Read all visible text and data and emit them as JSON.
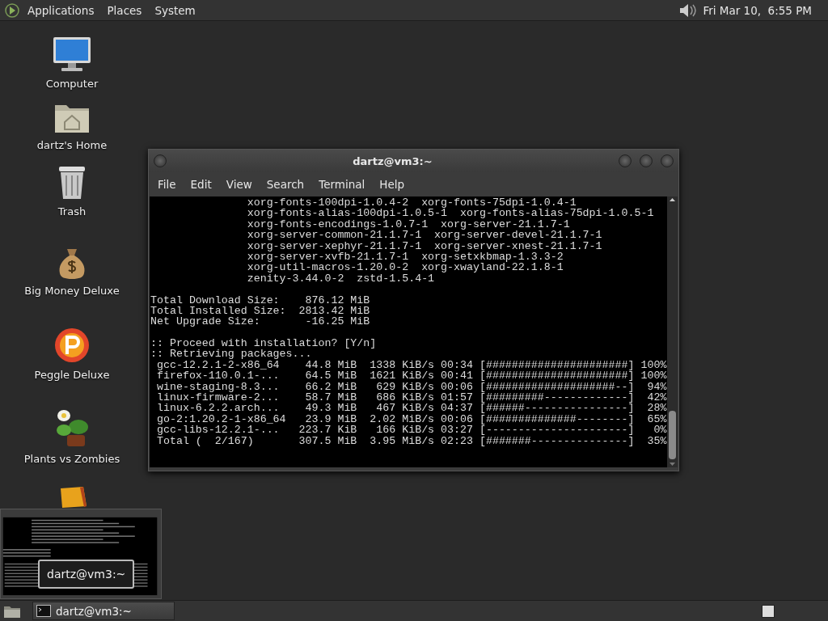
{
  "top_panel": {
    "menus": [
      "Applications",
      "Places",
      "System"
    ],
    "clock": "Fri Mar 10,  6:55 PM"
  },
  "desktop_icons": [
    {
      "label": "Computer",
      "kind": "computer"
    },
    {
      "label": "dartz's Home",
      "kind": "home"
    },
    {
      "label": "Trash",
      "kind": "trash"
    },
    {
      "label": "Big Money Deluxe",
      "kind": "money"
    },
    {
      "label": "Peggle Deluxe",
      "kind": "ball"
    },
    {
      "label": "Plants vs Zombies",
      "kind": "plant"
    },
    {
      "kind": "box"
    }
  ],
  "terminal": {
    "title": "dartz@vm3:~",
    "menu": [
      "File",
      "Edit",
      "View",
      "Search",
      "Terminal",
      "Help"
    ],
    "blocks": [
      [
        "               xorg-fonts-100dpi-1.0.4-2  xorg-fonts-75dpi-1.0.4-1",
        "               xorg-fonts-alias-100dpi-1.0.5-1  xorg-fonts-alias-75dpi-1.0.5-1",
        "               xorg-fonts-encodings-1.0.7-1  xorg-server-21.1.7-1",
        "               xorg-server-common-21.1.7-1  xorg-server-devel-21.1.7-1",
        "               xorg-server-xephyr-21.1.7-1  xorg-server-xnest-21.1.7-1",
        "               xorg-server-xvfb-21.1.7-1  xorg-setxkbmap-1.3.3-2",
        "               xorg-util-macros-1.20.0-2  xorg-xwayland-22.1.8-1",
        "               zenity-3.44.0-2  zstd-1.5.4-1"
      ],
      [
        "Total Download Size:    876.12 MiB",
        "Total Installed Size:  2813.42 MiB",
        "Net Upgrade Size:       -16.25 MiB"
      ],
      [
        ":: Proceed with installation? [Y/n]",
        ":: Retrieving packages...",
        " gcc-12.2.1-2-x86_64    44.8 MiB  1338 KiB/s 00:34 [######################] 100%",
        " firefox-110.0.1-...    64.5 MiB  1621 KiB/s 00:41 [######################] 100%",
        " wine-staging-8.3...    66.2 MiB   629 KiB/s 00:06 [####################--]  94%",
        " linux-firmware-2...    58.7 MiB   686 KiB/s 01:57 [#########-------------]  42%",
        " linux-6.2.2.arch...    49.3 MiB   467 KiB/s 04:37 [######----------------]  28%",
        " go-2:1.20.2-1-x86_64   23.9 MiB  2.02 MiB/s 00:06 [##############--------]  65%",
        " gcc-libs-12.2.1-...   223.7 KiB   166 KiB/s 03:27 [----------------------]   0%",
        " Total (  2/167)       307.5 MiB  3.95 MiB/s 02:23 [#######---------------]  35%"
      ]
    ]
  },
  "window_preview": {
    "tooltip": "dartz@vm3:~"
  },
  "taskbar": {
    "tasks": [
      {
        "label": "dartz@vm3:~"
      }
    ]
  }
}
